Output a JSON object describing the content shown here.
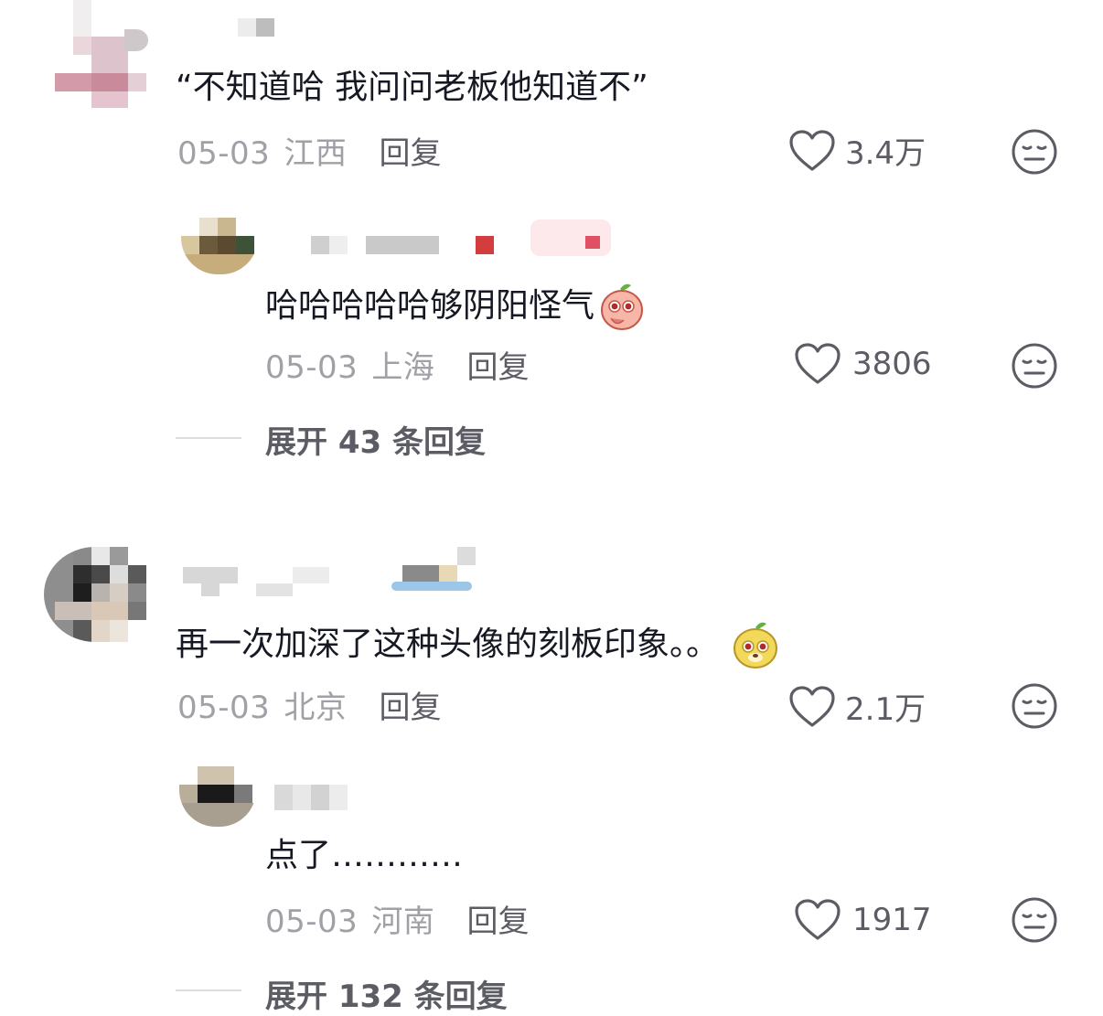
{
  "comments": [
    {
      "text": "“不知道哈 我问问老板他知道不”",
      "date": "05-03",
      "location": "江西",
      "reply_label": "回复",
      "likes": "3.4万",
      "replies": [
        {
          "text": "哈哈哈哈哈够阴阳怪气",
          "emoji": "peach-blush-emoji",
          "date": "05-03",
          "location": "上海",
          "reply_label": "回复",
          "likes": "3806"
        }
      ],
      "expand": "展开 43 条回复"
    },
    {
      "text": "再一次加深了这种头像的刻板印象。。",
      "emoji": "yellow-dog-emoji",
      "date": "05-03",
      "location": "北京",
      "reply_label": "回复",
      "likes": "2.1万",
      "replies": [
        {
          "text": "点了…………",
          "date": "05-03",
          "location": "河南",
          "reply_label": "回复",
          "likes": "1917"
        }
      ],
      "expand": "展开 132 条回复"
    }
  ],
  "icons": {
    "like": "heart-outline-icon",
    "dislike": "meh-face-icon"
  },
  "colors": {
    "text": "#161823",
    "meta": "#a0a1a6",
    "action": "#5c5d64"
  }
}
